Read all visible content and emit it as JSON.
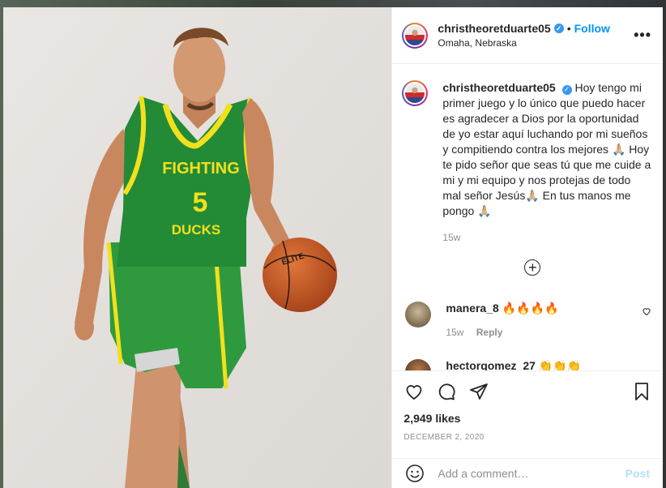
{
  "post": {
    "username": "christheoretduarte05",
    "follow_label": "Follow",
    "location": "Omaha, Nebraska",
    "more_icon": "•••",
    "jersey_line1": "FIGHTING",
    "jersey_number": "5",
    "jersey_line2": "DUCKS",
    "ball_brand": "ELITE"
  },
  "caption": {
    "username": "christheoretduarte05",
    "text": "Hoy tengo mi primer juego y lo único que puedo hacer es agradecer a Dios por la oportunidad de yo estar aquí luchando por mi sueños y compitiendo contra los mejores 🙏🏼 Hoy te pido señor que seas tú que me cuide a mi y mi equipo y nos protejas de todo mal señor Jesús🙏🏼 En tus manos me pongo 🙏🏼",
    "time": "15w"
  },
  "comments": [
    {
      "username": "manera_8",
      "text": "🔥🔥🔥🔥",
      "time": "15w",
      "reply_label": "Reply"
    },
    {
      "username": "hectorgomez_27",
      "text": "👏👏👏"
    }
  ],
  "actions": {
    "likes": "2,949 likes",
    "date": "DECEMBER 2, 2020"
  },
  "add_comment": {
    "placeholder": "Add a comment…",
    "post_label": "Post"
  },
  "colors": {
    "accent": "#0095f6",
    "jersey": "#1f8a3b",
    "trim": "#f2e01c"
  }
}
